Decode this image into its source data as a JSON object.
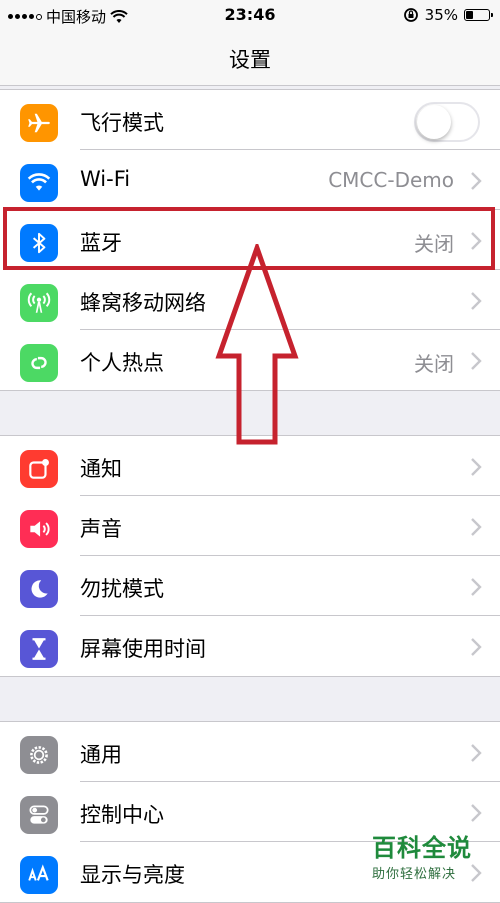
{
  "status_bar": {
    "carrier": "中国移动",
    "time": "23:46",
    "battery_percent": "35%",
    "battery_level": 0.35,
    "signal_bars": 4
  },
  "nav": {
    "title": "设置"
  },
  "groups": [
    {
      "items": [
        {
          "label": "飞行模式",
          "icon": "airplane-icon",
          "icon_color": "#ff9500",
          "toggle_on": false
        },
        {
          "label": "Wi-Fi",
          "value": "CMCC-Demo",
          "icon": "wifi-icon",
          "icon_color": "#007aff"
        },
        {
          "label": "蓝牙",
          "value": "关闭",
          "icon": "bluetooth-icon",
          "icon_color": "#007aff"
        },
        {
          "label": "蜂窝移动网络",
          "value": "",
          "icon": "cellular-icon",
          "icon_color": "#4cd964"
        },
        {
          "label": "个人热点",
          "value": "关闭",
          "icon": "hotspot-icon",
          "icon_color": "#4cd964"
        }
      ]
    },
    {
      "items": [
        {
          "label": "通知",
          "icon": "notification-icon",
          "icon_color": "#ff3b30"
        },
        {
          "label": "声音",
          "icon": "speaker-icon",
          "icon_color": "#ff2d55"
        },
        {
          "label": "勿扰模式",
          "icon": "moon-icon",
          "icon_color": "#5856d6"
        },
        {
          "label": "屏幕使用时间",
          "icon": "hourglass-icon",
          "icon_color": "#5856d6"
        }
      ]
    },
    {
      "items": [
        {
          "label": "通用",
          "icon": "gear-icon",
          "icon_color": "#8e8e93"
        },
        {
          "label": "控制中心",
          "icon": "switches-icon",
          "icon_color": "#8e8e93"
        },
        {
          "label": "显示与亮度",
          "icon": "text-size-icon",
          "icon_color": "#007aff"
        }
      ]
    }
  ],
  "annotation": {
    "highlight_color": "#c6222e"
  },
  "watermark": {
    "title": "百科全说",
    "subtitle": "助你轻松解决"
  }
}
